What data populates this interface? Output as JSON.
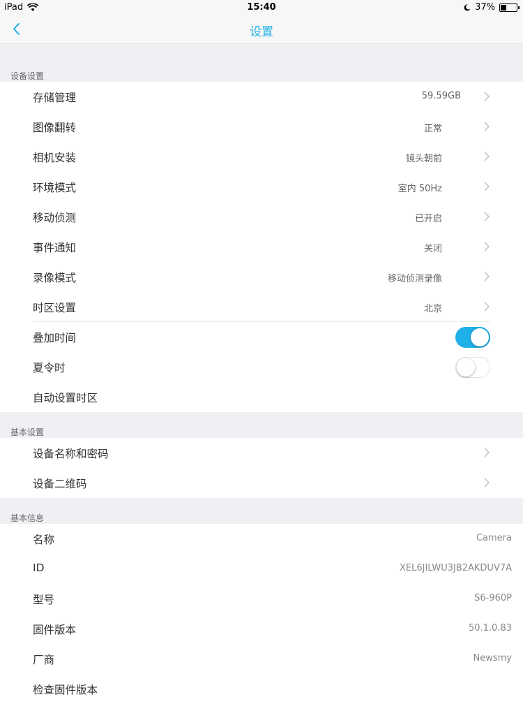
{
  "status_bar": {
    "device": "iPad",
    "time": "15:40",
    "battery": "37%",
    "battery_level": 0.37
  },
  "nav": {
    "title": "设置"
  },
  "device_settings": {
    "section_title": "设备设置",
    "items": [
      {
        "label": "存储管理",
        "value": "59.59GB"
      },
      {
        "label": "图像翻转",
        "value": "正常"
      },
      {
        "label": "相机安装",
        "value": "镜头朝前"
      },
      {
        "label": "环境模式",
        "value": "室内 50Hz"
      },
      {
        "label": "移动侦测",
        "value": "已开启"
      },
      {
        "label": "事件通知",
        "value": "关闭"
      },
      {
        "label": "录像模式",
        "value": "移动侦测录像"
      },
      {
        "label": "时区设置",
        "value": "北京"
      },
      {
        "label": "叠加时间",
        "toggle": true
      },
      {
        "label": "夏令时",
        "toggle": false
      },
      {
        "label": "自动设置时区"
      }
    ]
  },
  "basic_settings": {
    "section_title": "基本设置",
    "items": [
      {
        "label": "设备名称和密码"
      },
      {
        "label": "设备二维码"
      }
    ]
  },
  "basic_info": {
    "section_title": "基本信息",
    "items": [
      {
        "label": "名称",
        "value": "Camera"
      },
      {
        "label": "ID",
        "value": "XEL6JILWU3JB2AKDUV7A"
      },
      {
        "label": "型号",
        "value": "S6-960P"
      },
      {
        "label": "固件版本",
        "value": "50.1.0.83"
      },
      {
        "label": "厂商",
        "value": "Newsmy"
      },
      {
        "label": "检查固件版本"
      }
    ]
  },
  "colors": {
    "accent": "#1fb0ea",
    "background": "#efeff4"
  }
}
